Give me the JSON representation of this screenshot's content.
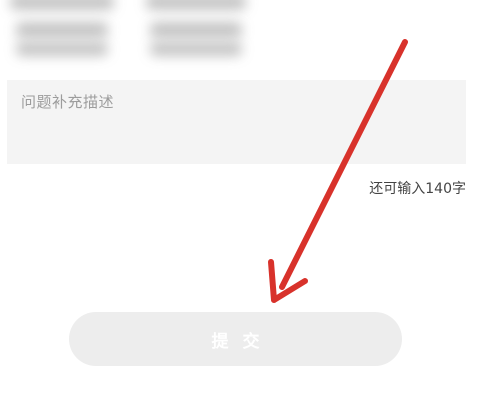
{
  "description_field": {
    "placeholder": "问题补充描述"
  },
  "char_counter": "还可输入140字",
  "submit_button": {
    "label": "提交"
  },
  "annotation": {
    "arrow_color": "#d8322b"
  },
  "colors": {
    "textarea_bg": "#f4f4f4",
    "button_bg": "#ededed"
  }
}
